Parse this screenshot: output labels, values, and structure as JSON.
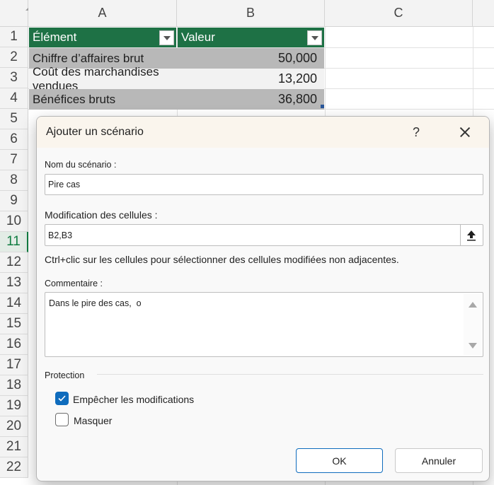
{
  "sheet": {
    "columns": [
      "A",
      "B",
      "C"
    ],
    "rows": [
      "1",
      "2",
      "3",
      "4",
      "5",
      "6",
      "7",
      "8",
      "9",
      "10",
      "11",
      "12",
      "13",
      "14",
      "15",
      "16",
      "17",
      "18",
      "19",
      "20",
      "21",
      "22"
    ],
    "active_row": "11",
    "table": {
      "headers": [
        "Élément",
        "Valeur"
      ],
      "rows": [
        {
          "item": "Chiffre d’affaires brut",
          "value": "50,000"
        },
        {
          "item": "Coût des marchandises vendues",
          "value": "13,200"
        },
        {
          "item": "Bénéfices bruts",
          "value": "36,800"
        }
      ]
    },
    "colors": {
      "table_header": "#1e7145",
      "band_dark": "#b8b8b8",
      "band_light": "#f2f2f2",
      "active_row": "#107c41"
    }
  },
  "dialog": {
    "title": "Ajouter un scénario",
    "help_glyph": "?",
    "close_icon": "close-icon",
    "name_label": "Nom du scénario :",
    "name_value": "Pire cas",
    "changing_label": "Modification des cellules :",
    "changing_value": "B2,B3",
    "ref_button_icon": "collapse-dialog-icon",
    "hint": "Ctrl+clic sur les cellules pour sélectionner des cellules modifiées non adjacentes.",
    "comment_label": "Commentaire :",
    "comment_value": "Dans le pire des cas,  o",
    "protection_label": "Protection",
    "prevent_changes_label": "Empêcher les modifications",
    "prevent_changes_checked": true,
    "hide_label": "Masquer",
    "hide_checked": false,
    "ok_label": "OK",
    "cancel_label": "Annuler",
    "accent": "#0f6cbd"
  }
}
